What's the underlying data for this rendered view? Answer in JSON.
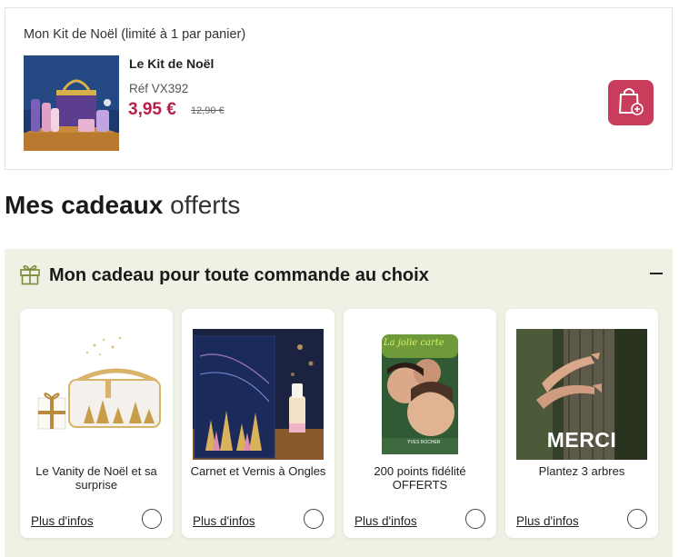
{
  "kit": {
    "heading": "Mon Kit de Noël (limité à 1 par panier)",
    "name": "Le Kit de Noël",
    "ref": "Réf VX392",
    "price": "3,95 €",
    "old_price": "12,90 €",
    "cart_icon": "shopping-bag-plus-icon"
  },
  "gifts": {
    "title_bold": "Mes cadeaux",
    "title_light": "offerts"
  },
  "offer": {
    "icon": "gift-icon",
    "title": "Mon cadeau pour toute commande au choix",
    "collapse_icon": "minus-icon",
    "cards": [
      {
        "label": "Le Vanity de Noël et sa surprise",
        "link": "Plus d'infos"
      },
      {
        "label": "Carnet et Vernis à Ongles",
        "link": "Plus d'infos"
      },
      {
        "label": "200 points fidélité OFFERTS",
        "link": "Plus d'infos",
        "image_text_top": "La jolie carte",
        "image_text_brand": "YVES ROCHER"
      },
      {
        "label": "Plantez 3 arbres",
        "link": "Plus d'infos",
        "image_text": "MERCI"
      }
    ]
  },
  "colors": {
    "accent": "#c93d5c",
    "price": "#b5204a",
    "panel_bg": "#eef1e4"
  }
}
